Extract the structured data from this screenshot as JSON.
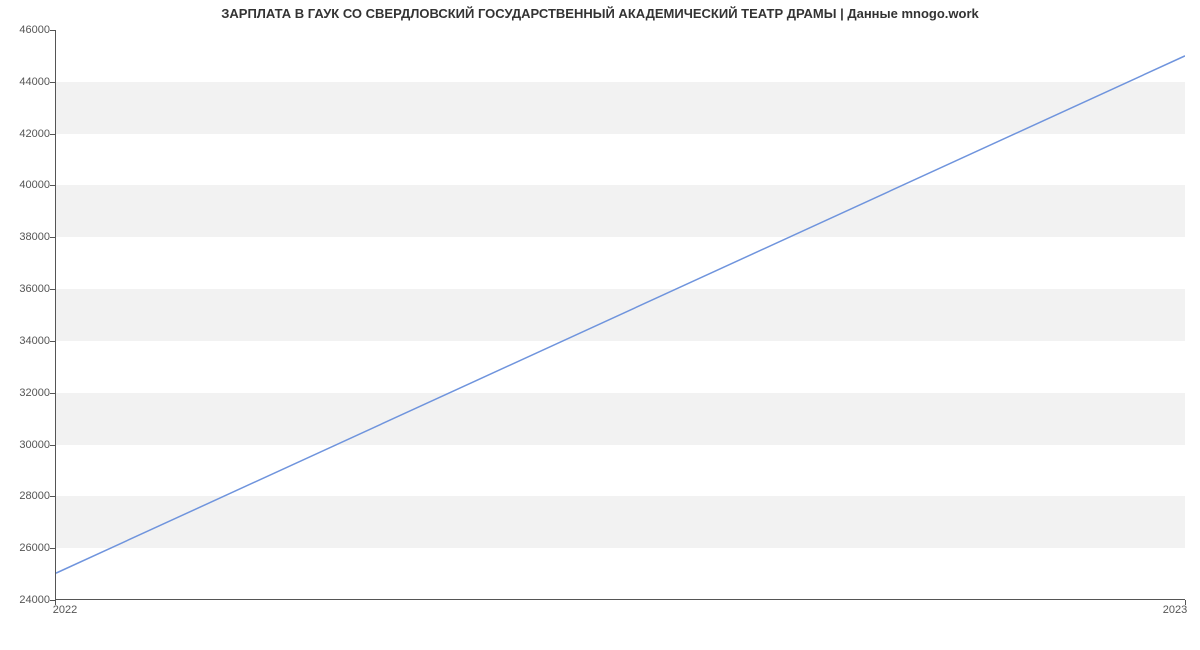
{
  "chart_data": {
    "type": "line",
    "title": "ЗАРПЛАТА В ГАУК СО СВЕРДЛОВСКИЙ ГОСУДАРСТВЕННЫЙ АКАДЕМИЧЕСКИЙ ТЕАТР ДРАМЫ | Данные mnogo.work",
    "xlabel": "",
    "ylabel": "",
    "x": [
      2022,
      2023
    ],
    "values": [
      25000,
      45000
    ],
    "x_ticks": [
      2022,
      2023
    ],
    "y_ticks": [
      24000,
      26000,
      28000,
      30000,
      32000,
      34000,
      36000,
      38000,
      40000,
      42000,
      44000,
      46000
    ],
    "xlim": [
      2022,
      2023
    ],
    "ylim": [
      24000,
      46000
    ],
    "line_color": "#6f94dd",
    "band_color": "#f2f2f2"
  }
}
